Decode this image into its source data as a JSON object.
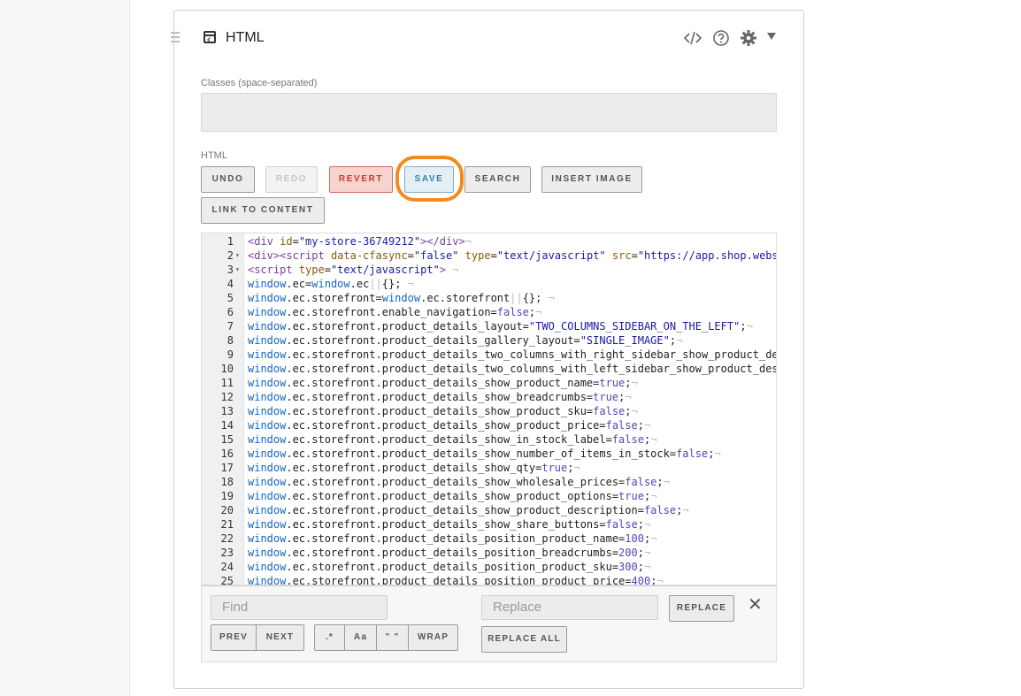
{
  "panel": {
    "title": "HTML",
    "classes_label": "Classes (space-separated)",
    "classes_value": "",
    "html_label": "HTML"
  },
  "toolbar": {
    "undo": "UNDO",
    "redo": "REDO",
    "revert": "REVERT",
    "save": "SAVE",
    "search": "SEARCH",
    "insert_image": "INSERT IMAGE",
    "link_to_content": "LINK TO CONTENT"
  },
  "icons": {
    "code": "code-icon",
    "help": "help-icon",
    "settings": "gear-icon",
    "collapse": "caret-down-icon"
  },
  "editor": {
    "lines": [
      {
        "n": "1",
        "fold": false,
        "html": "<span class='tag'>&lt;div</span> <span class='attr'>id</span>=<span class='str'>\"my-store-36749212\"</span><span class='tag'>&gt;&lt;/div&gt;</span><span class='pil'>¬</span>"
      },
      {
        "n": "2",
        "fold": true,
        "html": "<span class='tag'>&lt;div&gt;&lt;script</span> <span class='attr'>data-cfasync</span>=<span class='str'>\"false\"</span> <span class='attr'>type</span>=<span class='str'>\"text/javascript\"</span> <span class='attr'>src</span>=<span class='str'>\"https://app.shop.webs</span>"
      },
      {
        "n": "3",
        "fold": true,
        "html": "<span class='tag'>&lt;script</span> <span class='attr'>type</span>=<span class='str'>\"text/javascript\"</span><span class='tag'>&gt;</span> <span class='pil'>¬</span>"
      },
      {
        "n": "4",
        "fold": false,
        "html": "<span class='kw'>window</span>.ec=<span class='kw'>window</span>.ec<span class='pil'>||</span>{}; <span class='pil'>¬</span>"
      },
      {
        "n": "5",
        "fold": false,
        "html": "<span class='kw'>window</span>.ec.storefront=<span class='kw'>window</span>.ec.storefront<span class='pil'>||</span>{}; <span class='pil'>¬</span>"
      },
      {
        "n": "6",
        "fold": false,
        "html": "<span class='kw'>window</span>.ec.storefront.enable_navigation=<span class='val'>false</span>;<span class='pil'>¬</span>"
      },
      {
        "n": "7",
        "fold": false,
        "html": "<span class='kw'>window</span>.ec.storefront.product_details_layout=<span class='str'>\"TWO_COLUMNS_SIDEBAR_ON_THE_LEFT\"</span>;<span class='pil'>¬</span>"
      },
      {
        "n": "8",
        "fold": false,
        "html": "<span class='kw'>window</span>.ec.storefront.product_details_gallery_layout=<span class='str'>\"SINGLE_IMAGE\"</span>;<span class='pil'>¬</span>"
      },
      {
        "n": "9",
        "fold": false,
        "html": "<span class='kw'>window</span>.ec.storefront.product_details_two_columns_with_right_sidebar_show_product_de"
      },
      {
        "n": "10",
        "fold": false,
        "html": "<span class='kw'>window</span>.ec.storefront.product_details_two_columns_with_left_sidebar_show_product_des"
      },
      {
        "n": "11",
        "fold": false,
        "html": "<span class='kw'>window</span>.ec.storefront.product_details_show_product_name=<span class='val'>true</span>;<span class='pil'>¬</span>"
      },
      {
        "n": "12",
        "fold": false,
        "html": "<span class='kw'>window</span>.ec.storefront.product_details_show_breadcrumbs=<span class='val'>true</span>;<span class='pil'>¬</span>"
      },
      {
        "n": "13",
        "fold": false,
        "html": "<span class='kw'>window</span>.ec.storefront.product_details_show_product_sku=<span class='val'>false</span>;<span class='pil'>¬</span>"
      },
      {
        "n": "14",
        "fold": false,
        "html": "<span class='kw'>window</span>.ec.storefront.product_details_show_product_price=<span class='val'>false</span>;<span class='pil'>¬</span>"
      },
      {
        "n": "15",
        "fold": false,
        "html": "<span class='kw'>window</span>.ec.storefront.product_details_show_in_stock_label=<span class='val'>false</span>;<span class='pil'>¬</span>"
      },
      {
        "n": "16",
        "fold": false,
        "html": "<span class='kw'>window</span>.ec.storefront.product_details_show_number_of_items_in_stock=<span class='val'>false</span>;<span class='pil'>¬</span>"
      },
      {
        "n": "17",
        "fold": false,
        "html": "<span class='kw'>window</span>.ec.storefront.product_details_show_qty=<span class='val'>true</span>;<span class='pil'>¬</span>"
      },
      {
        "n": "18",
        "fold": false,
        "html": "<span class='kw'>window</span>.ec.storefront.product_details_show_wholesale_prices=<span class='val'>false</span>;<span class='pil'>¬</span>"
      },
      {
        "n": "19",
        "fold": false,
        "html": "<span class='kw'>window</span>.ec.storefront.product_details_show_product_options=<span class='val'>true</span>;<span class='pil'>¬</span>"
      },
      {
        "n": "20",
        "fold": false,
        "html": "<span class='kw'>window</span>.ec.storefront.product_details_show_product_description=<span class='val'>false</span>;<span class='pil'>¬</span>"
      },
      {
        "n": "21",
        "fold": false,
        "html": "<span class='kw'>window</span>.ec.storefront.product_details_show_share_buttons=<span class='val'>false</span>;<span class='pil'>¬</span>"
      },
      {
        "n": "22",
        "fold": false,
        "html": "<span class='kw'>window</span>.ec.storefront.product_details_position_product_name=<span class='val'>100</span>;<span class='pil'>¬</span>"
      },
      {
        "n": "23",
        "fold": false,
        "html": "<span class='kw'>window</span>.ec.storefront.product_details_position_breadcrumbs=<span class='val'>200</span>;<span class='pil'>¬</span>"
      },
      {
        "n": "24",
        "fold": false,
        "html": "<span class='kw'>window</span>.ec.storefront.product_details_position_product_sku=<span class='val'>300</span>;<span class='pil'>¬</span>"
      },
      {
        "n": "25",
        "fold": false,
        "html": "<span class='kw'>window</span>.ec.storefront.product_details_position_product_price=<span class='val'>400</span>;<span class='pil'>¬</span>"
      }
    ]
  },
  "find_bar": {
    "find_placeholder": "Find",
    "replace_placeholder": "Replace",
    "replace": "REPLACE",
    "replace_all": "REPLACE ALL",
    "prev": "PREV",
    "next": "NEXT",
    "regex": ".*",
    "case": "Aa",
    "whole_word": "\" \"",
    "wrap": "WRAP",
    "close": "✕"
  }
}
